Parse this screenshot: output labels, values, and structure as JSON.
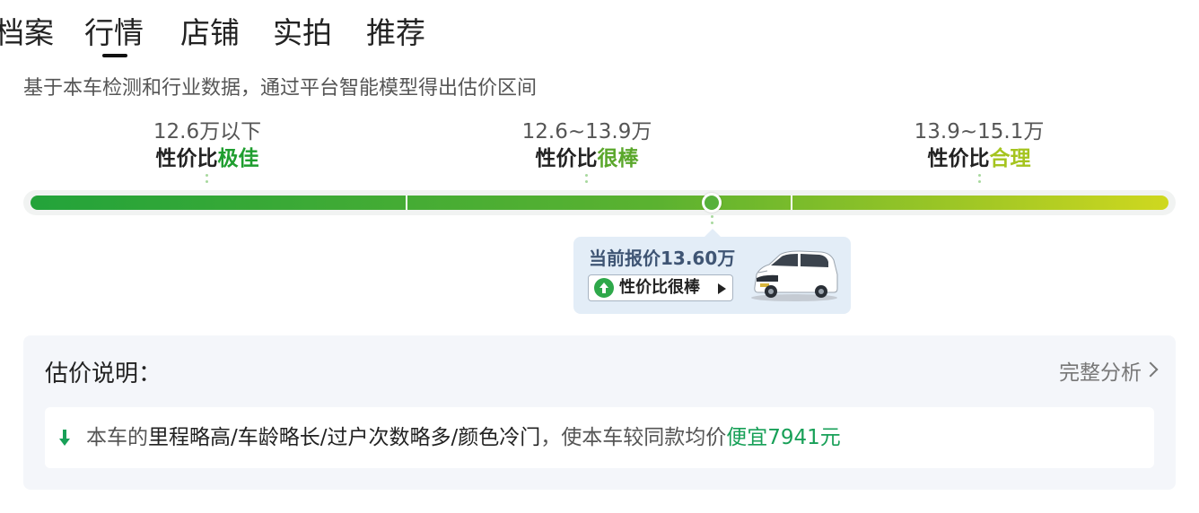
{
  "tabs": [
    {
      "label": "档案"
    },
    {
      "label": "行情"
    },
    {
      "label": "店铺"
    },
    {
      "label": "实拍"
    },
    {
      "label": "推荐"
    }
  ],
  "active_tab": "行情",
  "intro": "基于本车检测和行业数据，通过平台智能模型得出估价区间",
  "tiers": [
    {
      "range": "12.6万以下",
      "prefix": "性价比",
      "rating": "极佳",
      "rating_color": "#1f9e2f"
    },
    {
      "range": "12.6~13.9万",
      "prefix": "性价比",
      "rating": "很棒",
      "rating_color": "#5aa72b"
    },
    {
      "range": "13.9~15.1万",
      "prefix": "性价比",
      "rating": "合理",
      "rating_color": "#a5c41f"
    }
  ],
  "current_price": {
    "label": "当前报价13.60万",
    "badge": "性价比很棒",
    "badge_icon": "up-arrow-icon",
    "car_image": "white-mpv-car"
  },
  "explanation": {
    "title": "估价说明：",
    "link": "完整分析",
    "reason_icon": "down-arrow-icon",
    "reason_prefix": "本车的",
    "reason_factors": "里程略高/车龄略长/过户次数略多/颜色冷门",
    "reason_middle": "，使本车较同款均价",
    "reason_highlight": "便宜7941元"
  },
  "colors": {
    "accent_green": "#18a058",
    "bar_start": "#23a33a",
    "bar_end": "#cfd81f"
  }
}
